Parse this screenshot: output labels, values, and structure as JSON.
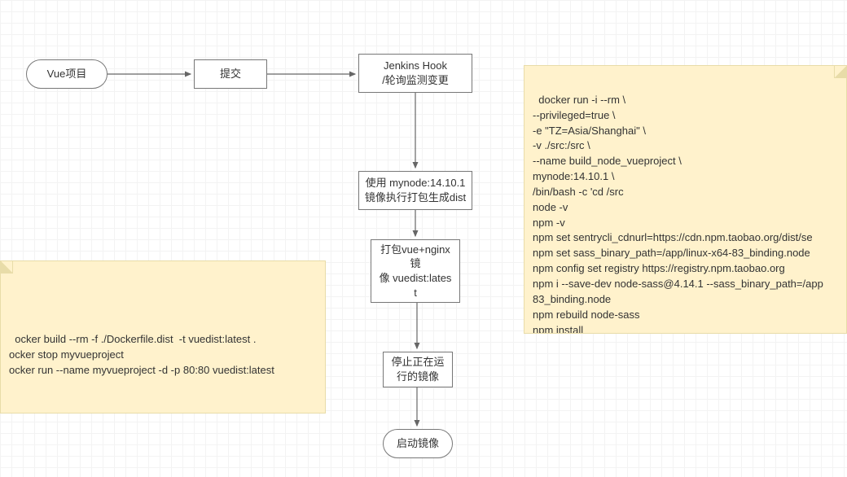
{
  "nodes": {
    "start": "Vue项目",
    "commit": "提交",
    "jenkins_line1": "Jenkins Hook",
    "jenkins_line2": "/轮询监测变更",
    "build_dist_line1": "使用 mynode:14.10.1",
    "build_dist_line2": "镜像执行打包生成dist",
    "pack_image_line1": "打包vue+nginx",
    "pack_image_line2": "镜",
    "pack_image_line3": "像 vuedist:lates",
    "pack_image_line4": "t",
    "stop_line1": "停止正在运",
    "stop_line2": "行的镜像",
    "run": "启动镜像"
  },
  "notes": {
    "left": "ocker build --rm -f ./Dockerfile.dist  -t vuedist:latest .\nocker stop myvueproject\nocker run --name myvueproject -d -p 80:80 vuedist:latest",
    "right": "docker run -i --rm \\\n--privileged=true \\\n-e \"TZ=Asia/Shanghai\" \\\n-v ./src:/src \\\n--name build_node_vueproject \\\nmynode:14.10.1 \\\n/bin/bash -c 'cd /src\nnode -v\nnpm -v\nnpm set sentrycli_cdnurl=https://cdn.npm.taobao.org/dist/se\nnpm set sass_binary_path=/app/linux-x64-83_binding.node\nnpm config set registry https://registry.npm.taobao.org\nnpm i --save-dev node-sass@4.14.1 --sass_binary_path=/app\n83_binding.node\nnpm rebuild node-sass\nnpm install\nnpm run prod'"
  }
}
